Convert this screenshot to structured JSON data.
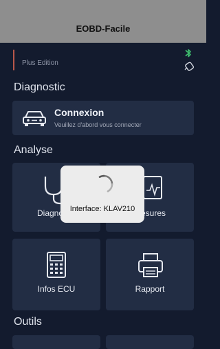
{
  "app": {
    "title": "EOBD-Facile"
  },
  "header": {
    "edition": "Plus Edition"
  },
  "sections": {
    "diagnostic": "Diagnostic",
    "analyse": "Analyse",
    "outils": "Outils"
  },
  "connexion": {
    "title": "Connexion",
    "subtitle": "Veuillez d'abord vous connecter"
  },
  "tiles": {
    "diagnostic": "Diagnostic",
    "mesures": "Mesures",
    "infos_ecu": "Infos ECU",
    "rapport": "Rapport"
  },
  "overlay": {
    "text": "Interface: KLAV210"
  },
  "colors": {
    "background": "#131b2e",
    "card": "#222d44",
    "accent_green": "#3fbf6f",
    "edition_bar": "#b8574a"
  }
}
